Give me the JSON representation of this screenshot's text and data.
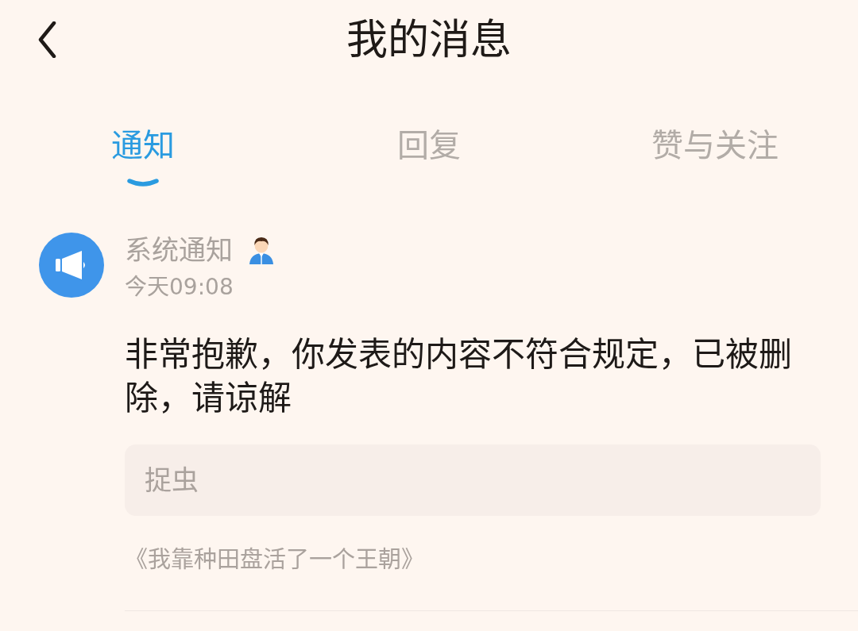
{
  "header": {
    "title": "我的消息"
  },
  "tabs": [
    {
      "label": "通知",
      "selected": true
    },
    {
      "label": "回复",
      "selected": false
    },
    {
      "label": "赞与关注",
      "selected": false
    }
  ],
  "messages": [
    {
      "sender": "系统通知",
      "time": "今天09:08",
      "body": "非常抱歉，你发表的内容不符合规定，已被删除，请谅解",
      "quote": "捉虫",
      "source": "《我靠种田盘活了一个王朝》"
    }
  ]
}
